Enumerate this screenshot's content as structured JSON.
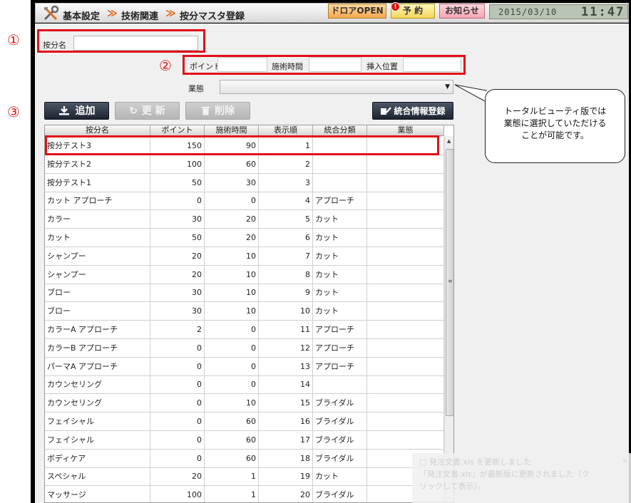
{
  "header": {
    "breadcrumb": [
      "基本設定",
      "技術関連",
      "按分マスタ登録"
    ],
    "buttons": {
      "door_open": "ドロアOPEN",
      "yoyaku": "予 約",
      "oshirase": "お知らせ"
    },
    "badge": "!",
    "clock": {
      "date": "2015/03/10",
      "time": "11:47"
    }
  },
  "markers": [
    "①",
    "②",
    "③"
  ],
  "form": {
    "anbun_label": "按分名",
    "anbun_value": "",
    "point_label": "ポイント",
    "point_value": "",
    "time_label": "施術時間",
    "time_value": "",
    "insert_label": "挿入位置",
    "insert_value": "",
    "gyotai_label": "業態",
    "gyotai_value": ""
  },
  "toolbar": {
    "add": "追加",
    "update": "更 新",
    "delete": "削除",
    "integrate": "統合情報登録"
  },
  "table": {
    "headers": [
      "按分名",
      "ポイント",
      "施術時間",
      "表示順",
      "統合分類",
      "業態"
    ],
    "rows": [
      [
        "按分テスト3",
        "150",
        "90",
        "1",
        "",
        ""
      ],
      [
        "按分テスト2",
        "100",
        "60",
        "2",
        "",
        ""
      ],
      [
        "按分テスト1",
        "50",
        "30",
        "3",
        "",
        ""
      ],
      [
        "カット アプローチ",
        "0",
        "0",
        "4",
        "アプローチ",
        ""
      ],
      [
        "カラー",
        "30",
        "20",
        "5",
        "カット",
        ""
      ],
      [
        "カット",
        "50",
        "20",
        "6",
        "カット",
        ""
      ],
      [
        "シャンプー",
        "20",
        "10",
        "7",
        "カット",
        ""
      ],
      [
        "シャンプー",
        "20",
        "10",
        "8",
        "カット",
        ""
      ],
      [
        "ブロー",
        "30",
        "10",
        "9",
        "カット",
        ""
      ],
      [
        "ブロー",
        "30",
        "10",
        "10",
        "カット",
        ""
      ],
      [
        "カラーA アプローチ",
        "2",
        "0",
        "11",
        "アプローチ",
        ""
      ],
      [
        "カラーB アプローチ",
        "0",
        "0",
        "12",
        "アプローチ",
        ""
      ],
      [
        "パーマA アプローチ",
        "0",
        "0",
        "13",
        "アプローチ",
        ""
      ],
      [
        "カウンセリング",
        "0",
        "0",
        "14",
        "",
        ""
      ],
      [
        "カウンセリング",
        "0",
        "10",
        "15",
        "ブライダル",
        ""
      ],
      [
        "フェイシャル",
        "0",
        "60",
        "16",
        "ブライダル",
        ""
      ],
      [
        "フェイシャル",
        "0",
        "60",
        "17",
        "ブライダル",
        ""
      ],
      [
        "ボディケア",
        "0",
        "60",
        "18",
        "ブライダル",
        ""
      ],
      [
        "スペシャル",
        "20",
        "1",
        "19",
        "カット",
        ""
      ],
      [
        "マッサージ",
        "100",
        "1",
        "20",
        "ブライダル",
        ""
      ]
    ]
  },
  "callout": {
    "lines": [
      "トータルビューティ版では",
      "業態に選択していただける",
      "ことが可能です。"
    ]
  },
  "toast": {
    "lines": [
      "□ 発注文書.xls を更新しました",
      "「発注文書.xls」が最新版に更新されました（ク",
      "リックして表示）。"
    ],
    "close": "×"
  }
}
